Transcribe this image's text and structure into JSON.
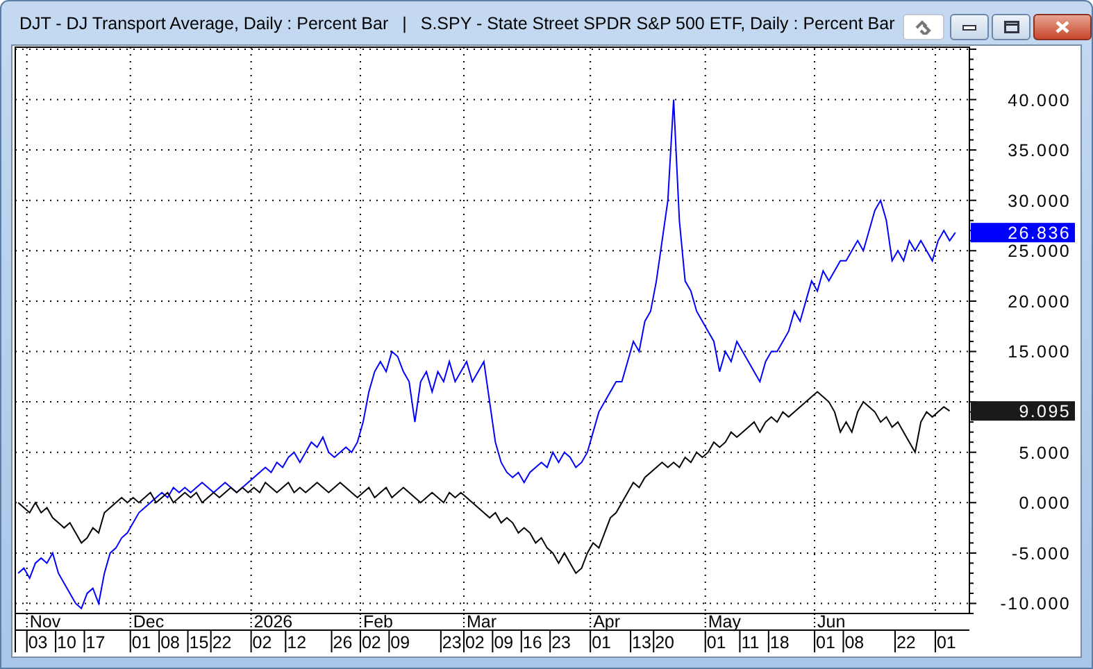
{
  "window": {
    "separator": "|",
    "buttons": [
      {
        "kind": "link"
      },
      {
        "kind": "minimize"
      },
      {
        "kind": "maximize"
      },
      {
        "kind": "close"
      }
    ]
  },
  "chart": {
    "chart_data": {
      "type": "line",
      "grid": true,
      "series": [
        {
          "name": "DJT - DJ Transport Average, Daily : Percent Bar",
          "color": "#0000ff",
          "values": [
            -7,
            -6.5,
            -7.5,
            -6,
            -5.5,
            -6,
            -5,
            -7,
            -8,
            -9,
            -10,
            -10.5,
            -9,
            -8.5,
            -10,
            -7,
            -5,
            -4.5,
            -3.5,
            -3,
            -2,
            -1,
            -0.5,
            0,
            0.5,
            1,
            0.5,
            1.5,
            1,
            1.5,
            1,
            1.5,
            2,
            1.5,
            1,
            1.5,
            2,
            1.5,
            1,
            1.5,
            2,
            2.5,
            3,
            3.5,
            3,
            4,
            3.5,
            4.5,
            5,
            4,
            5,
            6,
            5.5,
            6.5,
            5,
            4.5,
            5,
            5.5,
            5,
            6,
            8,
            11,
            13,
            14,
            13,
            15,
            14.5,
            13,
            12,
            8,
            12,
            13,
            11,
            13,
            12,
            14,
            12,
            13,
            14,
            12,
            13,
            14,
            10,
            6,
            4,
            3,
            2.5,
            3,
            2,
            3,
            3.5,
            4,
            3.5,
            5,
            4,
            5,
            4.5,
            3.5,
            4,
            5,
            7,
            9,
            10,
            11,
            12,
            12,
            14,
            16,
            15,
            18,
            19,
            22,
            26,
            30,
            40,
            28,
            22,
            21,
            19,
            18,
            17,
            16,
            13,
            15,
            14,
            16,
            15,
            14,
            13,
            12,
            14,
            15,
            15,
            16,
            17,
            19,
            18,
            20,
            22,
            21,
            23,
            22,
            23,
            24,
            24,
            25,
            26,
            25,
            27,
            29,
            30,
            28,
            24,
            25,
            24,
            26,
            25,
            26,
            25,
            24,
            26,
            27,
            26,
            26.8
          ]
        },
        {
          "name": "S.SPY - State Street SPDR S&P 500 ETF, Daily : Percent Bar",
          "color": "#000000",
          "values": [
            0,
            -0.5,
            -1,
            0,
            -1,
            -0.5,
            -1.5,
            -2,
            -2.5,
            -2,
            -3,
            -4,
            -3.5,
            -2.5,
            -3,
            -1,
            -0.5,
            0,
            0.5,
            0,
            0.5,
            0,
            0.5,
            1,
            0,
            0.5,
            1,
            0,
            0.5,
            1,
            0.5,
            1,
            0,
            0.5,
            1,
            0.5,
            1,
            1.5,
            1,
            1.5,
            1,
            1.5,
            1,
            2,
            1.5,
            1,
            1.5,
            2,
            1,
            1.5,
            1,
            1.5,
            2,
            1.5,
            1,
            1.5,
            2,
            1.5,
            1,
            0.5,
            1,
            1.5,
            0.5,
            1,
            1.5,
            0.5,
            1,
            1.5,
            1,
            0.5,
            0,
            0.5,
            1,
            0.5,
            0,
            1,
            0.5,
            1,
            0.5,
            0,
            -0.5,
            -1,
            -1.5,
            -1,
            -2,
            -1.5,
            -2,
            -3,
            -2.5,
            -3,
            -4,
            -3.5,
            -4.5,
            -5,
            -6,
            -5,
            -6,
            -7,
            -6.5,
            -5,
            -4,
            -4.5,
            -3,
            -1.5,
            -1,
            0,
            1,
            2,
            1.5,
            2.5,
            3,
            3.5,
            4,
            3.5,
            4,
            3.5,
            4.5,
            4,
            5,
            4.5,
            5,
            6,
            5.5,
            6,
            7,
            6.5,
            7,
            7.5,
            8,
            7,
            8,
            8.5,
            8,
            9,
            8.5,
            9,
            9.5,
            10,
            10.5,
            11,
            10.5,
            10,
            9,
            7,
            8,
            7,
            9,
            10,
            9.5,
            9,
            8,
            8.5,
            7.5,
            8,
            7,
            6,
            5,
            8,
            9,
            8.5,
            9,
            9.5,
            9.1
          ]
        }
      ],
      "ylim": [
        -11,
        45.2
      ],
      "yticks": [
        {
          "value": 40,
          "label": "40.000"
        },
        {
          "value": 35,
          "label": "35.000"
        },
        {
          "value": 30,
          "label": "30.000"
        },
        {
          "value": 25,
          "label": "25.000"
        },
        {
          "value": 20,
          "label": "20.000"
        },
        {
          "value": 15,
          "label": "15.000"
        },
        {
          "value": 5,
          "label": "5.000"
        },
        {
          "value": 0,
          "label": "0.000"
        },
        {
          "value": -5,
          "label": "-5.000"
        },
        {
          "value": -10,
          "label": "-10.000"
        }
      ]
    },
    "last_value_badges": [
      {
        "text": "26.836",
        "color": "#0000ff"
      },
      {
        "text": "9.095",
        "color": "#1a1a1a"
      }
    ],
    "x_axis": {
      "months": [
        "Nov",
        "Dec",
        "2026",
        "Feb",
        "Mar",
        "Apr",
        "May",
        "Jun"
      ],
      "days": [
        "03",
        "10",
        "17",
        "01",
        "08",
        "15",
        "22",
        "02",
        "12",
        "26",
        "02",
        "09",
        "23",
        "02",
        "09",
        "16",
        "23",
        "01",
        "13",
        "20",
        "01",
        "11",
        "18",
        "01",
        "08",
        "22",
        "01"
      ]
    }
  }
}
